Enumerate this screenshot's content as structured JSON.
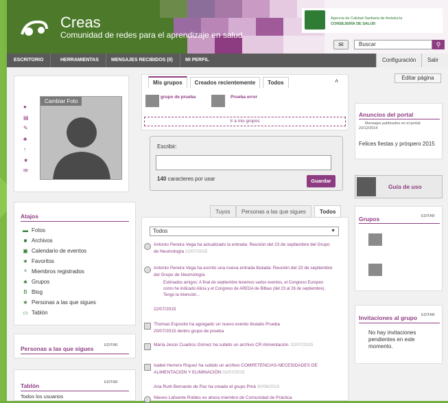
{
  "brand": {
    "title": "Creas",
    "subtitle": "Comunidad de redes para el aprendizaje en salud"
  },
  "gov": {
    "line1": "Agencia de Calidad Sanitaria de Andalucía",
    "line2": "CONSEJERÍA DE SALUD"
  },
  "search": {
    "placeholder": "Buscar"
  },
  "nav": {
    "items": [
      "ESCRITORIO",
      "HERRAMIENTAS",
      "MENSAJES RECIBIDOS (0)",
      "MI PERFIL"
    ],
    "config": "Configuración",
    "logout": "Salir"
  },
  "edit_page": "Editar página",
  "profile": {
    "change_photo": "Cambiar Foto"
  },
  "groups_tabs": {
    "tabs": [
      "Mis grupos",
      "Creados recientemente",
      "Todos"
    ],
    "groups": [
      "grupo de prueba",
      "Prueba error"
    ],
    "link": "Ir a mis grupos"
  },
  "write": {
    "label": "Escribir:",
    "counter_value": "140",
    "counter_text": "caracteres por usar",
    "button": "Guardar"
  },
  "feed": {
    "tabs": [
      "Tuyos",
      "Personas a las que sigues",
      "Todos"
    ],
    "filter": "Todos",
    "posts": [
      {
        "text": "Antonio Pereira Vega ha actualizado la entrada: Reunión del 23 de septiembre del Grupo de Neumología",
        "date": "22/07/2015"
      },
      {
        "text": "Antonio Pereira Vega ha escrito una nueva entrada titulada: Reunión del 23 de septiembre del Grupo de Neumología",
        "excerpt": "Estimados amigos: A final de septiembre tenemos varios eventos, el Congreso Europeo como he indicado Alicia y el Congreso de AREDA de Bilbao (del 23 al 26 de septiembre). Tengo la intención...",
        "date": "22/07/2015"
      },
      {
        "text": "Thomas Esposito ha agregado un nuevo evento titulado Prueba",
        "date": "20/07/2015 dentro grupo de prueba"
      },
      {
        "text": "María Jesús Cuadros Gómez ha subido un archivo CR Alimentación.",
        "date": "02/07/2015"
      },
      {
        "text": "Isabel Herrero Ríquez ha subido un archivo COMPETENCIAS-NECESIDADES DE ALIMENTACIÓN Y ELIMINACIÓN",
        "date": "01/07/2015"
      },
      {
        "text": "Ana Ruth Bernardo de Paz ha creado el grupo Pmá",
        "date": "30/06/2015"
      },
      {
        "text": "Nieves Lafuente Robles es ahora miembro de Comunidad de Práctica"
      }
    ]
  },
  "atajos": {
    "title": "Atajos",
    "items": [
      {
        "label": "Fotos",
        "icon": "photos-icon"
      },
      {
        "label": "Archivos",
        "icon": "folder-icon"
      },
      {
        "label": "Calendario de eventos",
        "icon": "calendar-icon"
      },
      {
        "label": "Favoritos",
        "icon": "star-icon"
      },
      {
        "label": "Miembros registrados",
        "icon": "members-icon"
      },
      {
        "label": "Grupos",
        "icon": "groups-icon"
      },
      {
        "label": "Blog",
        "icon": "blog-icon"
      },
      {
        "label": "Personas a las que sigues",
        "icon": "following-icon"
      },
      {
        "label": "Tablón",
        "icon": "board-icon"
      }
    ]
  },
  "following": {
    "title": "Personas a las que sigues",
    "edit": "EDITAR"
  },
  "tablon": {
    "title": "Tablón",
    "edit": "EDITAR",
    "first": "Todos los usuarios"
  },
  "anuncios": {
    "title": "Anuncios del portal",
    "meta": "Mensajes publicados en el portal:",
    "date": "23/12/2014",
    "text": "Felices fiestas y próspero 2015"
  },
  "guia": {
    "label": "Guía de uso"
  },
  "grupos": {
    "title": "Grupos",
    "edit": "EDITAR"
  },
  "invitaciones": {
    "title": "Invitaciones al grupo",
    "edit": "EDITAR",
    "text": "No hay invitaciones pendientes en este momento."
  },
  "colors": {
    "brand": "#8e3c82",
    "header": "#4c7a2a",
    "nav": "#5a5a5a"
  }
}
